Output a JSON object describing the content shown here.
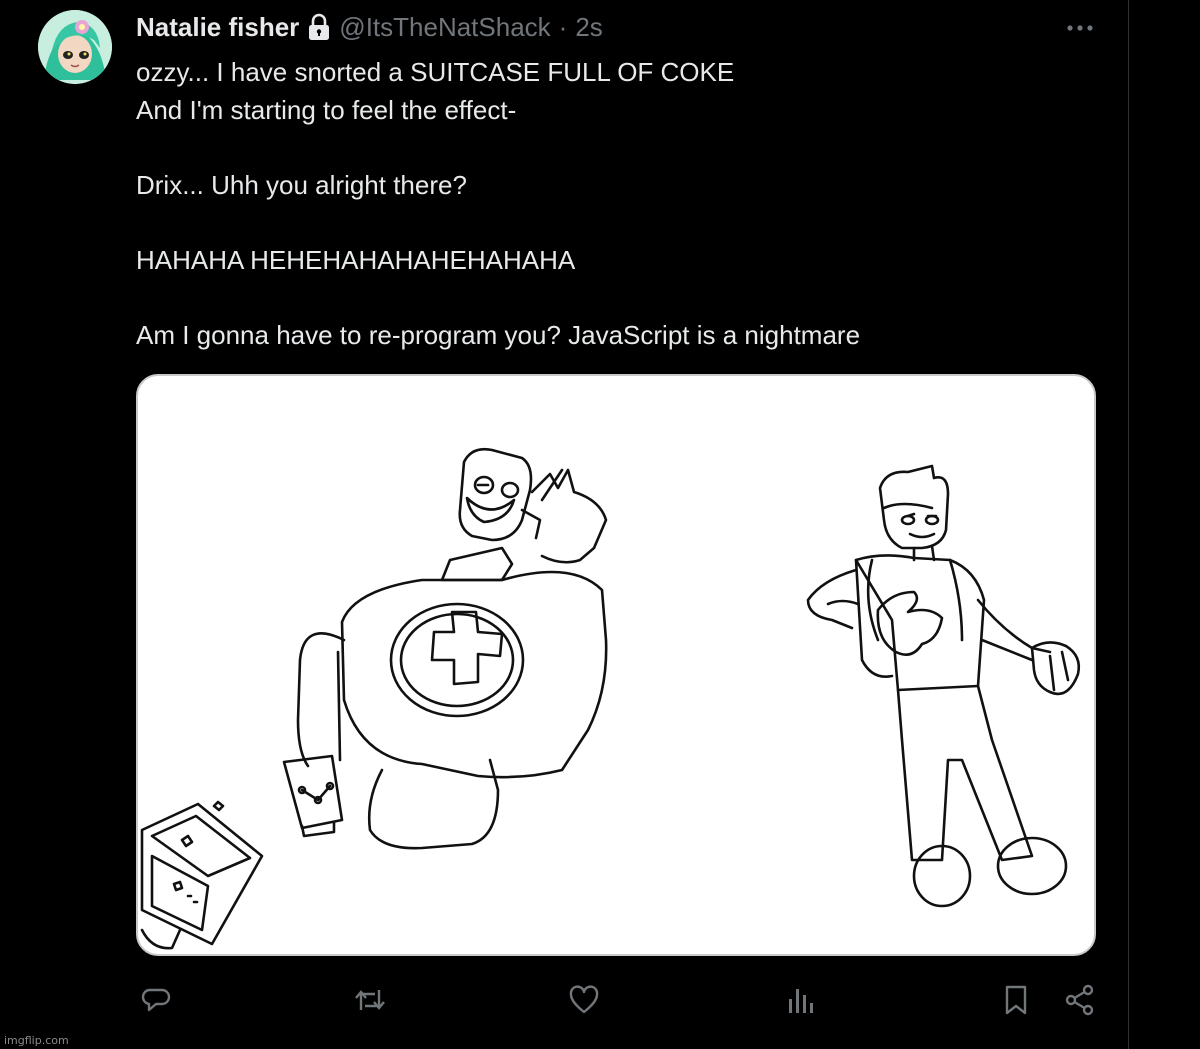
{
  "tweet": {
    "author_name": "Natalie fisher",
    "handle": "@ItsTheNatShack",
    "separator": "·",
    "time": "2s",
    "locked": true,
    "lines": [
      "ozzy... I have snorted a SUITCASE FULL OF COKE",
      "And I'm starting to feel the effect-",
      "",
      "Drix... Uhh you alright there?",
      "",
      "HAHAHA HEHEHAHAHAHEHAHAHA",
      "",
      "Am I gonna have to re-program you? JavaScript is a nightmare"
    ]
  },
  "icons": {
    "lock": "lock-icon",
    "more": "more-icon",
    "reply": "reply-icon",
    "retweet": "retweet-icon",
    "like": "heart-icon",
    "views": "views-icon",
    "bookmark": "bookmark-icon",
    "share": "share-icon"
  },
  "colors": {
    "background": "#000000",
    "text": "#e7e9ea",
    "secondary": "#71767b",
    "icon": "#71767b"
  },
  "watermark": "imgflip.com"
}
